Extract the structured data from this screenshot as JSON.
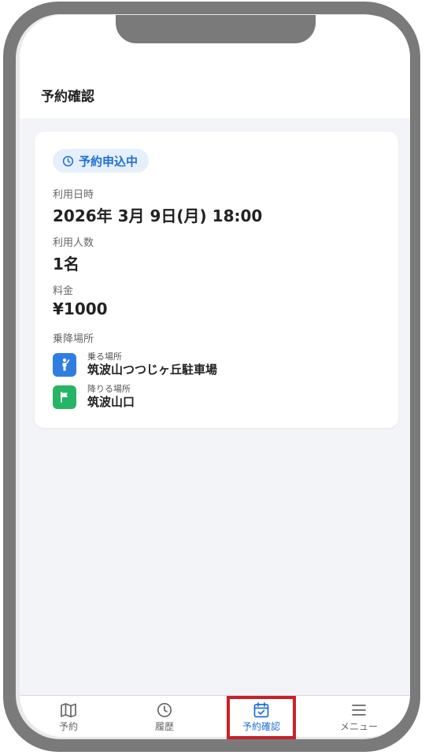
{
  "header": {
    "title": "予約確認"
  },
  "reservation": {
    "status": "予約申込中",
    "datetime_label": "利用日時",
    "datetime_value": "2026年 3月 9日(月) 18:00",
    "people_label": "利用人数",
    "people_value": "1名",
    "fare_label": "料金",
    "fare_value": "¥1000",
    "places_label": "乗降場所",
    "pickup": {
      "sub": "乗る場所",
      "name": "筑波山つつじヶ丘駐車場",
      "icon": "person-icon",
      "color": "#2f7de1"
    },
    "dropoff": {
      "sub": "降りる場所",
      "name": "筑波山口",
      "icon": "flag-icon",
      "color": "#27b565"
    }
  },
  "nav": {
    "items": [
      {
        "label": "予約",
        "icon": "map-icon"
      },
      {
        "label": "履歴",
        "icon": "clock-icon"
      },
      {
        "label": "予約確認",
        "icon": "calendar-check-icon",
        "active": true
      },
      {
        "label": "メニュー",
        "icon": "menu-icon"
      }
    ]
  },
  "colors": {
    "accent": "#1f6fd6",
    "highlight": "#c8202a"
  }
}
